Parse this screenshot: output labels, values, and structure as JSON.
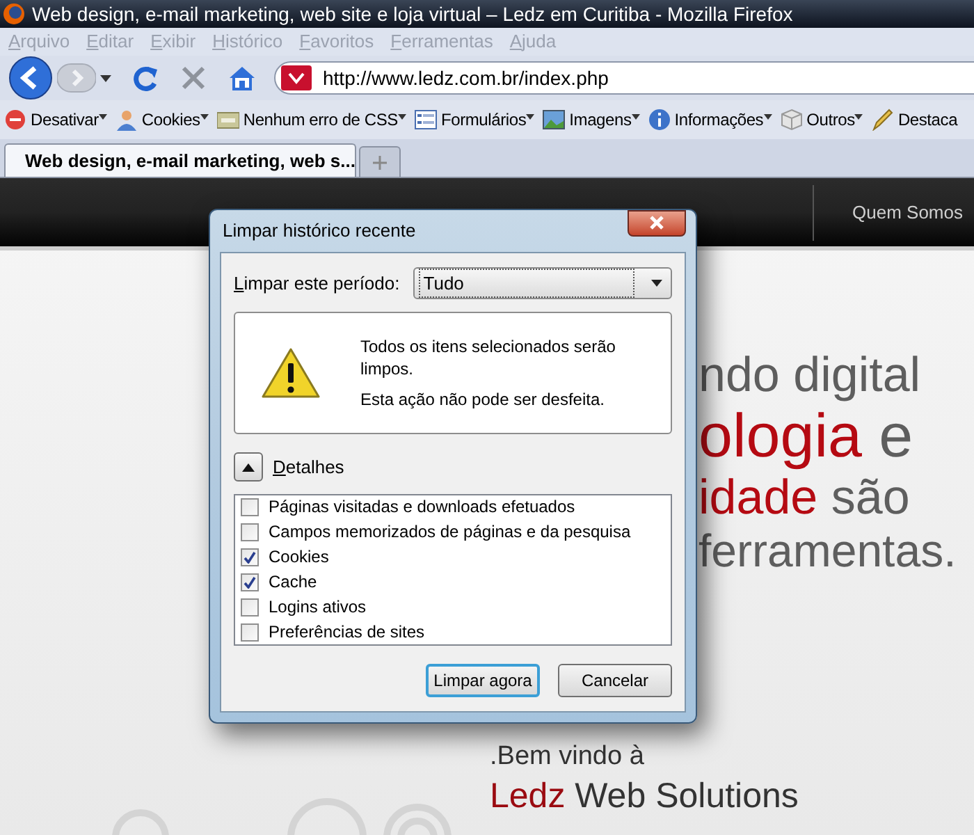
{
  "window": {
    "title": "Web design, e-mail marketing, web site e loja virtual – Ledz em Curitiba - Mozilla Firefox"
  },
  "menu": {
    "disabled": true,
    "items": [
      "Arquivo",
      "Editar",
      "Exibir",
      "Histórico",
      "Favoritos",
      "Ferramentas",
      "Ajuda"
    ]
  },
  "address_bar": {
    "value": "http://www.ledz.com.br/index.php"
  },
  "toolbar": [
    {
      "label": "Desativar",
      "kind": "stop",
      "dropdown": true
    },
    {
      "label": "Cookies",
      "kind": "person",
      "dropdown": true
    },
    {
      "label": "Nenhum erro de CSS",
      "kind": "css",
      "dropdown": true
    },
    {
      "label": "Formulários",
      "kind": "form",
      "dropdown": true
    },
    {
      "label": "Imagens",
      "kind": "image",
      "dropdown": true
    },
    {
      "label": "Informações",
      "kind": "info",
      "dropdown": true
    },
    {
      "label": "Outros",
      "kind": "cube",
      "dropdown": true
    },
    {
      "label": "Destaca",
      "kind": "pen",
      "dropdown": false
    }
  ],
  "tabs": [
    {
      "label": "Web design, e-mail marketing, web s...",
      "selected": true
    }
  ],
  "site": {
    "nav": [
      "Quem Somos"
    ],
    "hero": [
      [
        {
          "text": "ndo digital",
          "accent": false
        }
      ],
      [
        {
          "text": "ologia",
          "accent": true
        },
        {
          "text": " e",
          "accent": false
        }
      ],
      [
        {
          "text": "idade",
          "accent": true
        },
        {
          "text": " são",
          "accent": false
        }
      ],
      [
        {
          "text": "ferramentas.",
          "accent": false
        }
      ]
    ],
    "welcome": ".Bem vindo à",
    "brand": [
      {
        "text": "Ledz",
        "accent": true
      },
      {
        "text": " Web Solutions",
        "accent": false
      }
    ]
  },
  "dialog": {
    "title": "Limpar histórico recente",
    "period_label": "Limpar este período:",
    "period_value": "Tudo",
    "warning": [
      "Todos os itens selecionados serão limpos.",
      "Esta ação não pode ser desfeita."
    ],
    "details": {
      "label": "Detalhes",
      "expanded": true
    },
    "items": [
      {
        "label": "Páginas visitadas e downloads efetuados",
        "checked": false
      },
      {
        "label": "Campos memorizados de páginas e da pesquisa",
        "checked": false
      },
      {
        "label": "Cookies",
        "checked": true
      },
      {
        "label": "Cache",
        "checked": true
      },
      {
        "label": "Logins ativos",
        "checked": false
      },
      {
        "label": "Preferências de sites",
        "checked": false
      }
    ],
    "buttons": [
      {
        "label": "Limpar agora",
        "default": true
      },
      {
        "label": "Cancelar",
        "default": false
      }
    ]
  }
}
